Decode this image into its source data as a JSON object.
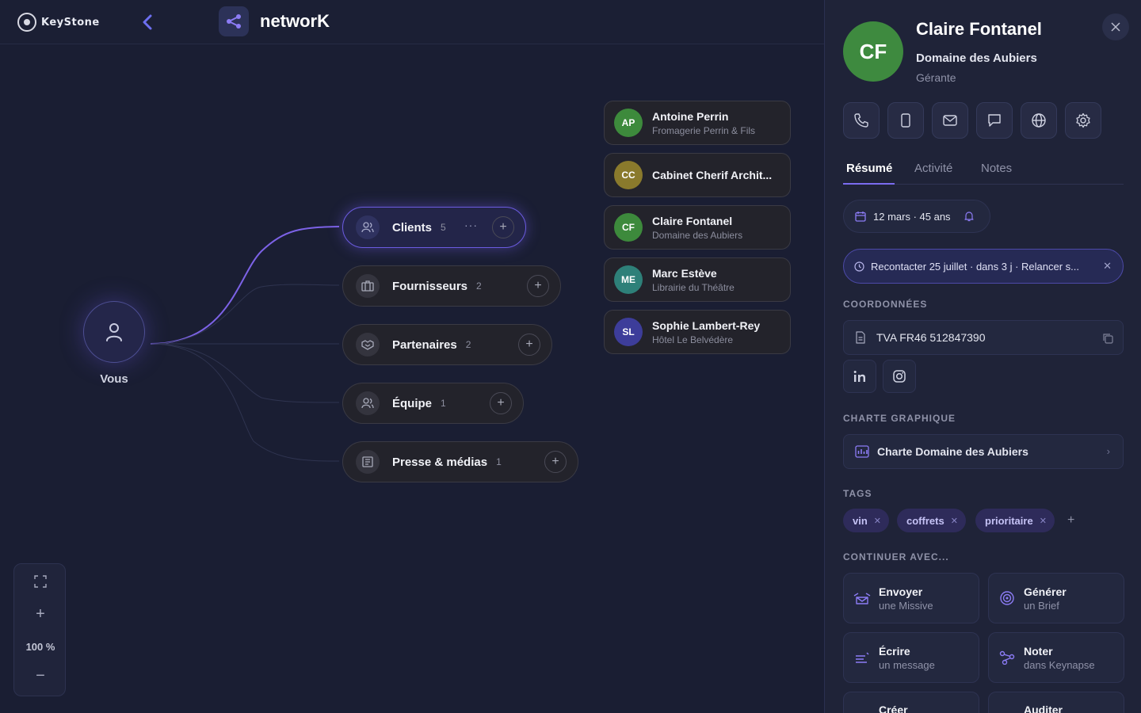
{
  "header": {
    "logo_text": "KeyStone",
    "app_title": "networK"
  },
  "canvas": {
    "you_label": "Vous",
    "groups": [
      {
        "label": "Clients",
        "count": "5",
        "active": true
      },
      {
        "label": "Fournisseurs",
        "count": "2"
      },
      {
        "label": "Partenaires",
        "count": "2"
      },
      {
        "label": "Équipe",
        "count": "1"
      },
      {
        "label": "Presse & médias",
        "count": "1"
      }
    ],
    "clients": [
      {
        "initials": "AP",
        "name": "Antoine Perrin",
        "company": "Fromagerie Perrin & Fils",
        "color": "#3d8a3c"
      },
      {
        "initials": "CC",
        "name": "Cabinet Cherif Archit...",
        "company": "",
        "color": "#8a7a2c"
      },
      {
        "initials": "CF",
        "name": "Claire Fontanel",
        "company": "Domaine des Aubiers",
        "color": "#3d8a3c"
      },
      {
        "initials": "ME",
        "name": "Marc Estève",
        "company": "Librairie du Théâtre",
        "color": "#2e8079"
      },
      {
        "initials": "SL",
        "name": "Sophie Lambert-Rey",
        "company": "Hôtel Le Belvédère",
        "color": "#3d3d9a"
      }
    ],
    "zoom_level": "100 %"
  },
  "contact": {
    "initials": "CF",
    "name": "Claire Fontanel",
    "company": "Domaine des Aubiers",
    "role": "Gérante",
    "avatar_color": "#3e8a3f",
    "actions": [
      "phone-icon",
      "mobile-icon",
      "mail-icon",
      "message-icon",
      "globe-icon",
      "settings-icon"
    ],
    "tabs": [
      "Résumé",
      "Activité",
      "Notes"
    ],
    "birthday": "12 mars · 45 ans",
    "reminder": "Recontacter 25 juillet · dans 3 j · Relancer s...",
    "sections": {
      "coordinates": "COORDONNÉES",
      "brand": "CHARTE GRAPHIQUE",
      "tags": "TAGS",
      "continue": "CONTINUER AVEC..."
    },
    "vat": "TVA FR46 512847390",
    "brand_chart": "Charte Domaine des Aubiers",
    "tags": [
      "vin",
      "coffrets",
      "prioritaire"
    ],
    "continue_with": [
      {
        "title": "Envoyer",
        "sub": "une Missive"
      },
      {
        "title": "Générer",
        "sub": "un Brief"
      },
      {
        "title": "Écrire",
        "sub": "un message"
      },
      {
        "title": "Noter",
        "sub": "dans Keynapse"
      },
      {
        "title": "Créer",
        "sub": ""
      },
      {
        "title": "Auditer",
        "sub": ""
      }
    ]
  },
  "colors": {
    "accent": "#7a6cf0",
    "background": "#1a1e33",
    "panel": "#1f2338"
  }
}
